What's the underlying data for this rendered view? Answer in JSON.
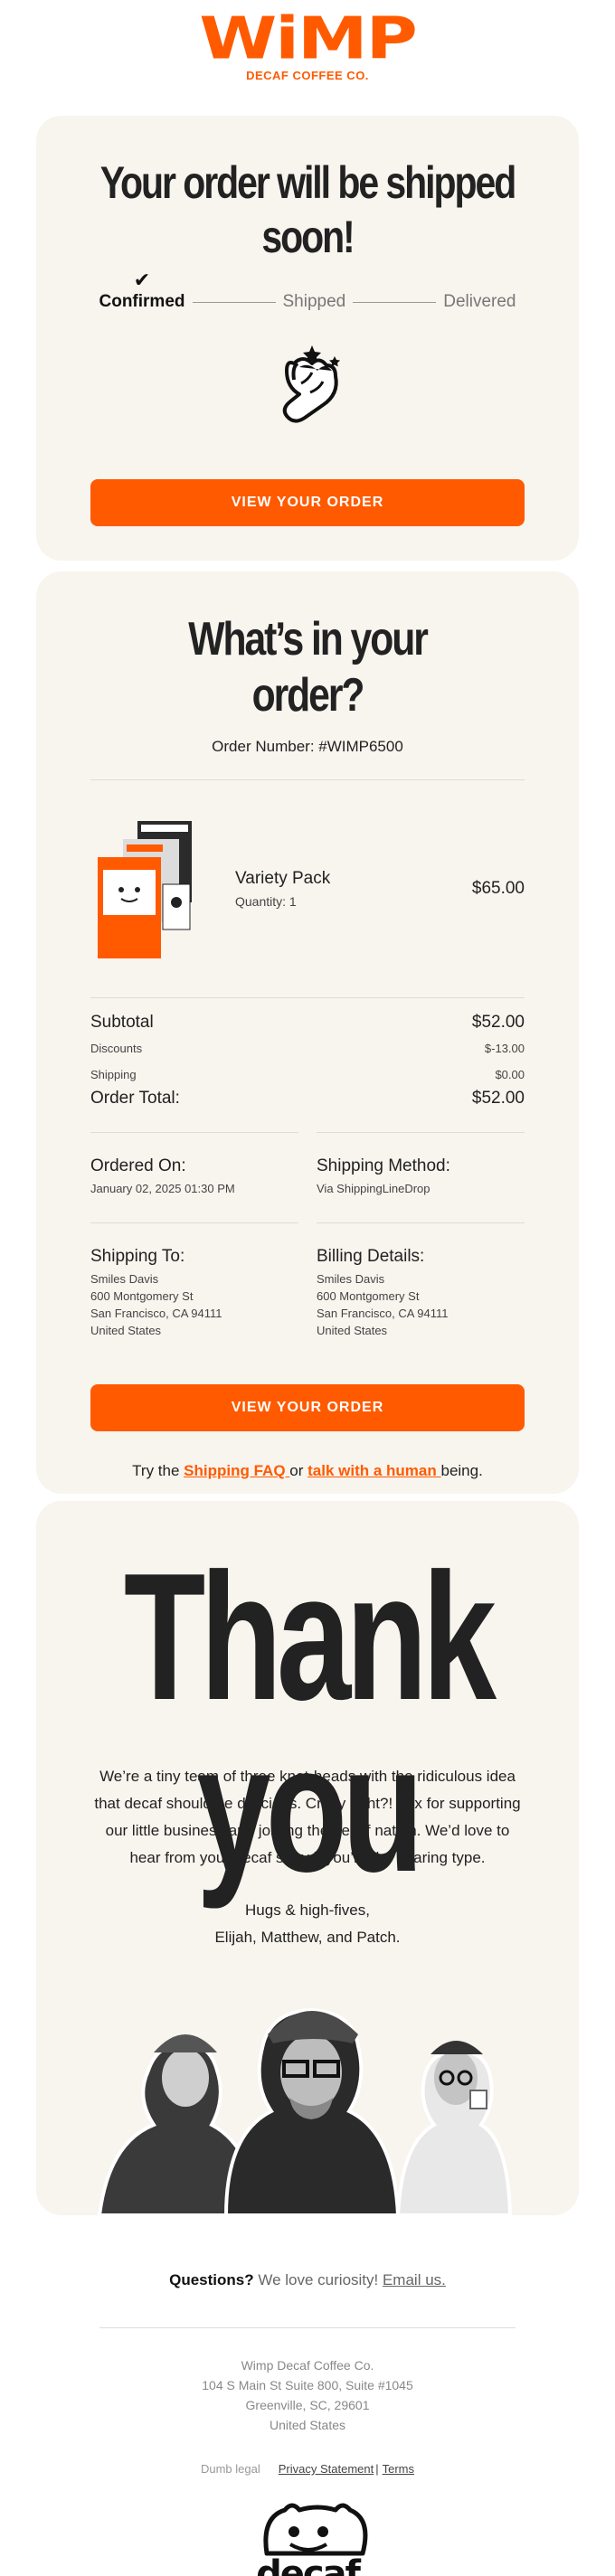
{
  "brand": {
    "logo_text": "WiMP",
    "logo_sub": "DECAF COFFEE CO.",
    "accent": "#ff5a00"
  },
  "shipping_card": {
    "headline": "Your order will be shipped soon!",
    "steps": [
      {
        "label": "Confirmed",
        "done": true
      },
      {
        "label": "Shipped",
        "done": false
      },
      {
        "label": "Delivered",
        "done": false
      }
    ],
    "illustration": "hand-fingers-crossed-icon",
    "button_label": "VIEW YOUR ORDER"
  },
  "order_card": {
    "headline": "What’s in your order?",
    "order_number": "Order Number: #WIMP6500",
    "item": {
      "name": "Variety Pack",
      "quantity": "Quantity: 1",
      "price": "$65.00"
    },
    "summary": {
      "subtotal_label": "Subtotal",
      "subtotal_value": "$52.00",
      "discounts_label": "Discounts",
      "discounts_value": "$-13.00",
      "shipping_label": "Shipping",
      "shipping_value": "$0.00",
      "total_label": "Order Total:",
      "total_value": "$52.00"
    },
    "ordered_on": {
      "title": "Ordered On:",
      "value": "January 02, 2025 01:30 PM"
    },
    "shipping_method": {
      "title": "Shipping Method:",
      "value": "Via ShippingLineDrop"
    },
    "shipping_to": {
      "title": "Shipping To:",
      "lines": [
        "Smiles Davis",
        "600 Montgomery St",
        "San Francisco, CA 94111",
        "United States"
      ]
    },
    "billing": {
      "title": "Billing Details:",
      "lines": [
        "Smiles Davis",
        "600 Montgomery St",
        "San Francisco, CA 94111",
        "United States"
      ]
    },
    "button_label": "VIEW YOUR ORDER",
    "faq": {
      "prefix": "Try the ",
      "faq_link": "Shipping FAQ ",
      "middle": " or ",
      "human_link": "talk with a human ",
      "suffix": "being."
    }
  },
  "thanks_card": {
    "headline": "Thank you",
    "body": "We’re a tiny team of three knot-heads with the ridiculous idea that decaf should be delicious. Crazy right?! Thx for supporting our little business and joining the decaf nation. We’d love to hear from your decaf story if you’re the sharing type.",
    "sign_1": "Hugs & high-fives,",
    "sign_2": "Elijah, Matthew, and Patch."
  },
  "footer": {
    "questions_bold": "Questions?",
    "questions_text": " We love curiosity! ",
    "email_link": "Email us.",
    "address": [
      "Wimp Decaf Coffee Co.",
      "104 S Main St Suite 800, Suite #1045",
      "Greenville, SC, 29601",
      "United States"
    ],
    "legal_text": "Dumb legal",
    "privacy_link": "Privacy Statement",
    "separator": "|",
    "terms_link": "Terms",
    "bottom_logo": "decaf"
  }
}
